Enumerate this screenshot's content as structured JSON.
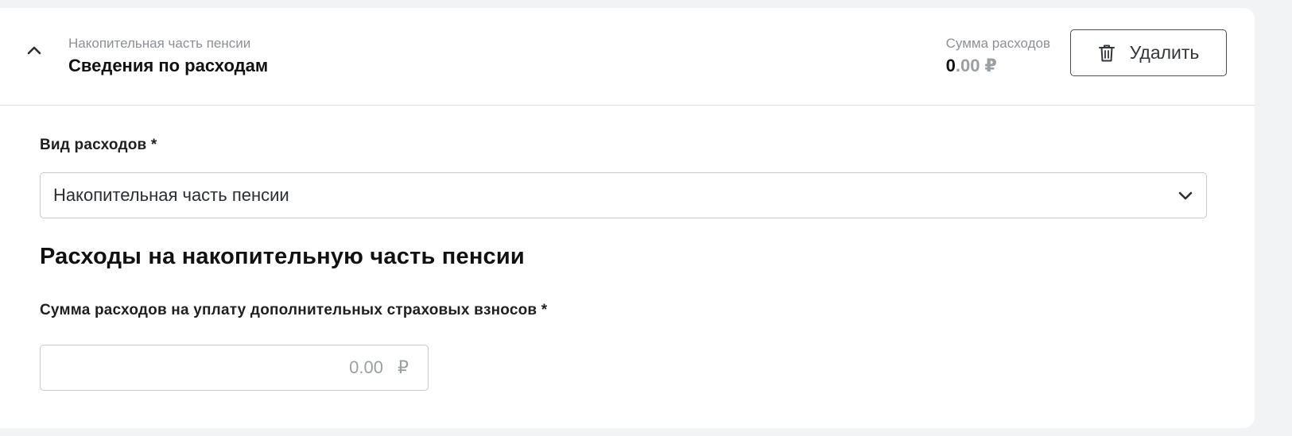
{
  "section": {
    "subtitle": "Накопительная часть пенсии",
    "title": "Сведения по расходам",
    "sum_label": "Сумма расходов",
    "sum_int": "0",
    "sum_frac": ".00",
    "currency": "₽",
    "delete_label": "Удалить"
  },
  "expense_type": {
    "label": "Вид расходов *",
    "value": "Накопительная часть пенсии"
  },
  "subsection": {
    "title": "Расходы на накопительную часть пенсии"
  },
  "amount": {
    "label": "Сумма расходов на уплату дополнительных страховых взносов *",
    "placeholder": "0.00",
    "currency": "₽"
  },
  "icons": {
    "collapse": "chevron-up-icon",
    "delete": "trash-icon",
    "select": "chevron-down-icon"
  }
}
